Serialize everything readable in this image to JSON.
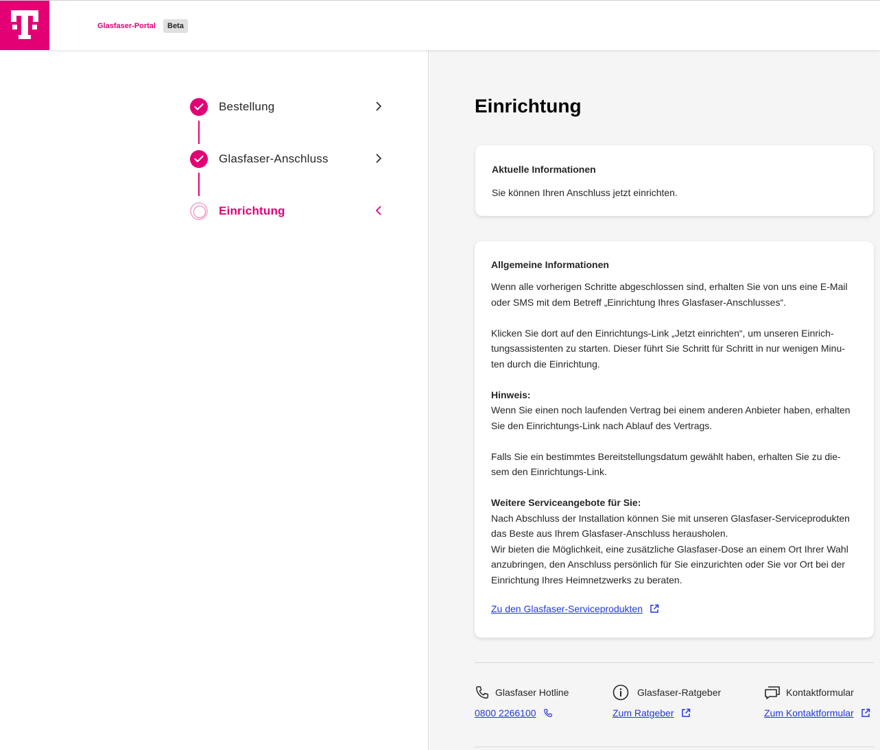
{
  "header": {
    "portal_name": "Glasfaser-Portal",
    "badge": "Beta",
    "brand_color": "#e20074"
  },
  "steps": [
    {
      "label": "Bestellung",
      "state": "done",
      "icon": "check-icon"
    },
    {
      "label": "Glasfaser-Anschluss",
      "state": "done",
      "icon": "check-icon"
    },
    {
      "label": "Einrichtung",
      "state": "current",
      "icon": "open-circle-icon"
    }
  ],
  "main": {
    "title": "Einrichtung",
    "current_info": {
      "title": "Aktuelle Informationen",
      "text": "Sie können Ihren Anschluss jetzt einrichten."
    },
    "general_info": {
      "title": "Allgemeine Informationen",
      "p1_line1": "Wenn alle vorherigen Schritte abgeschlossen sind, erhalten Sie von uns eine E-Mail",
      "p1_line2": "oder SMS mit dem Betreff „Einrichtung Ihres Glasfaser-Anschlusses“.",
      "p2_line1": "Klicken Sie dort auf den Einrichtungs-Link „Jetzt einrichten“, um unseren Einrich-",
      "p2_line2": "tungsassistenten zu starten. Dieser führt Sie Schritt für Schritt in nur wenigen Minu-",
      "p2_line3": "ten durch die Einrichtung.",
      "hint_title": "Hinweis:",
      "hint_line1": "Wenn Sie einen noch laufenden Vertrag bei einem anderen Anbieter haben, erhalten",
      "hint_line2": "Sie den Einrichtungs-Link nach Ablauf des Vertrags.",
      "p3_line1": "Falls Sie ein bestimmtes Bereitstellungsdatum gewählt haben, erhalten Sie zu die-",
      "p3_line2": "sem den Einrichtungs-Link.",
      "service_title": "Weitere Serviceangebote für Sie:",
      "service_line1": "Nach Abschluss der Installation können Sie mit unseren Glasfaser-Serviceprodukten",
      "service_line2": "das Beste aus Ihrem Glasfaser-Anschluss herausholen.",
      "service_line3": "Wir bieten die Möglichkeit, eine zusätzliche Glasfaser-Dose an einem Ort Ihrer Wahl",
      "service_line4": "anzubringen, den Anschluss persönlich für Sie einzurichten oder Sie vor Ort bei der",
      "service_line5": "Einrichtung Ihres Heimnetzwerks zu beraten.",
      "service_link": "Zu den Glasfaser-Serviceprodukten"
    }
  },
  "contact": [
    {
      "title": "Glasfaser Hotline",
      "link": "0800 2266100",
      "icon": "phone-icon"
    },
    {
      "title": "Glasfaser-Ratgeber",
      "link": "Zum Ratgeber",
      "icon": "info-icon"
    },
    {
      "title": "Kontaktformular",
      "link": "Zum Kontaktformular",
      "icon": "chat-icon"
    }
  ]
}
